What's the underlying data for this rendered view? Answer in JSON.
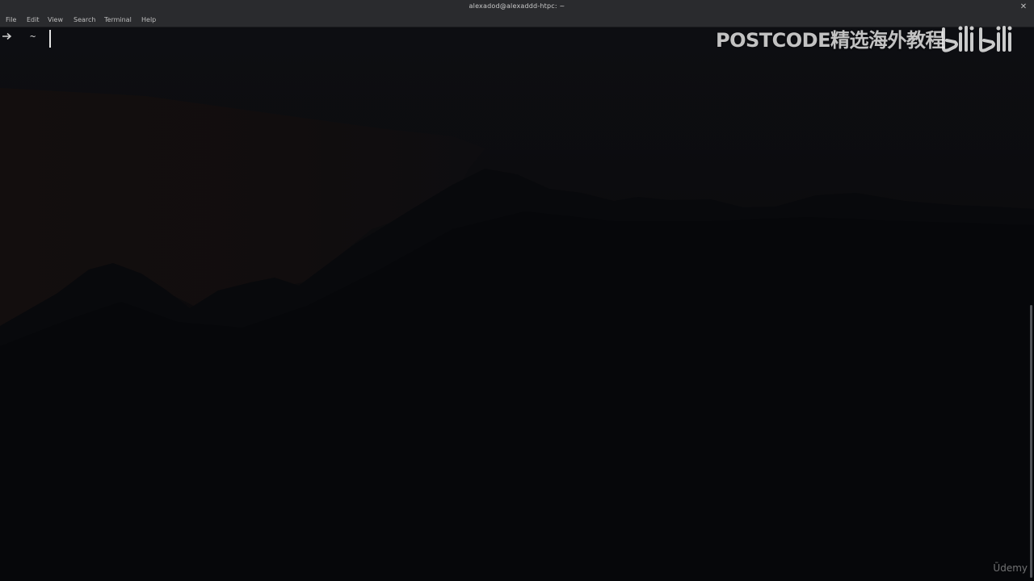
{
  "window": {
    "title": "alexadod@alexaddd-htpc: ~",
    "close_glyph": "✕"
  },
  "menu": {
    "items": [
      "File",
      "Edit",
      "View",
      "Search",
      "Terminal",
      "Help"
    ]
  },
  "terminal": {
    "prompt_dir": "~"
  },
  "overlay": {
    "watermark": "POSTCODE精选海外教程",
    "logo_text": "bilibili",
    "corner_brand": "Ūdemy"
  },
  "colors": {
    "titlebar": "#2a2b2e",
    "terminal_bg": "#070709",
    "text": "#c9c9c9",
    "cursor": "#e6e6e6"
  }
}
